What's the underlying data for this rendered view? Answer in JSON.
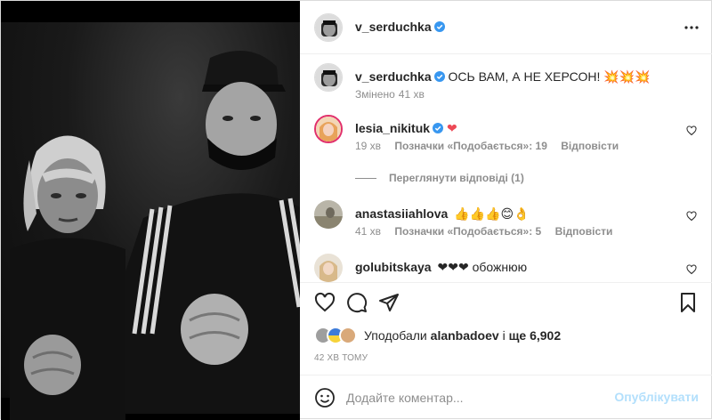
{
  "post": {
    "author": "v_serduchka",
    "caption": "ОСЬ ВАМ, А НЕ ХЕРСОН! 💥💥💥",
    "edited_label": "Змінено",
    "edited_time": "41 хв"
  },
  "comments": [
    {
      "user": "lesia_nikituk",
      "text": "❤",
      "time": "19 хв",
      "likes_label": "Позначки «Подобається»: 19",
      "reply_label": "Відповісти",
      "verified": true
    },
    {
      "user": "anastasiiahlova",
      "text": "👍👍👍😊👌",
      "time": "41 хв",
      "likes_label": "Позначки «Подобається»: 5",
      "reply_label": "Відповісти",
      "verified": false
    },
    {
      "user": "golubitskaya",
      "text": "❤❤❤ обожнюю",
      "verified": false
    }
  ],
  "view_replies": "Переглянути відповіді (1)",
  "likes": {
    "prefix": "Уподобали",
    "user": "alanbadoev",
    "suffix": "і",
    "more": "ще 6,902"
  },
  "posted_ago": "42 ХВ ТОМУ",
  "add_comment": {
    "placeholder": "Додайте коментар...",
    "publish_label": "Опублікувати"
  },
  "icons": {
    "more": "more-icon",
    "like": "heart-icon",
    "comment": "comment-icon",
    "share": "share-icon",
    "save": "bookmark-icon",
    "emoji": "emoji-icon",
    "verified": "verified-badge-icon"
  },
  "colors": {
    "verified": "#3897f0",
    "heart": "#ed4956",
    "publish_disabled": "#b2dffc",
    "muted": "#8e8e8e"
  }
}
